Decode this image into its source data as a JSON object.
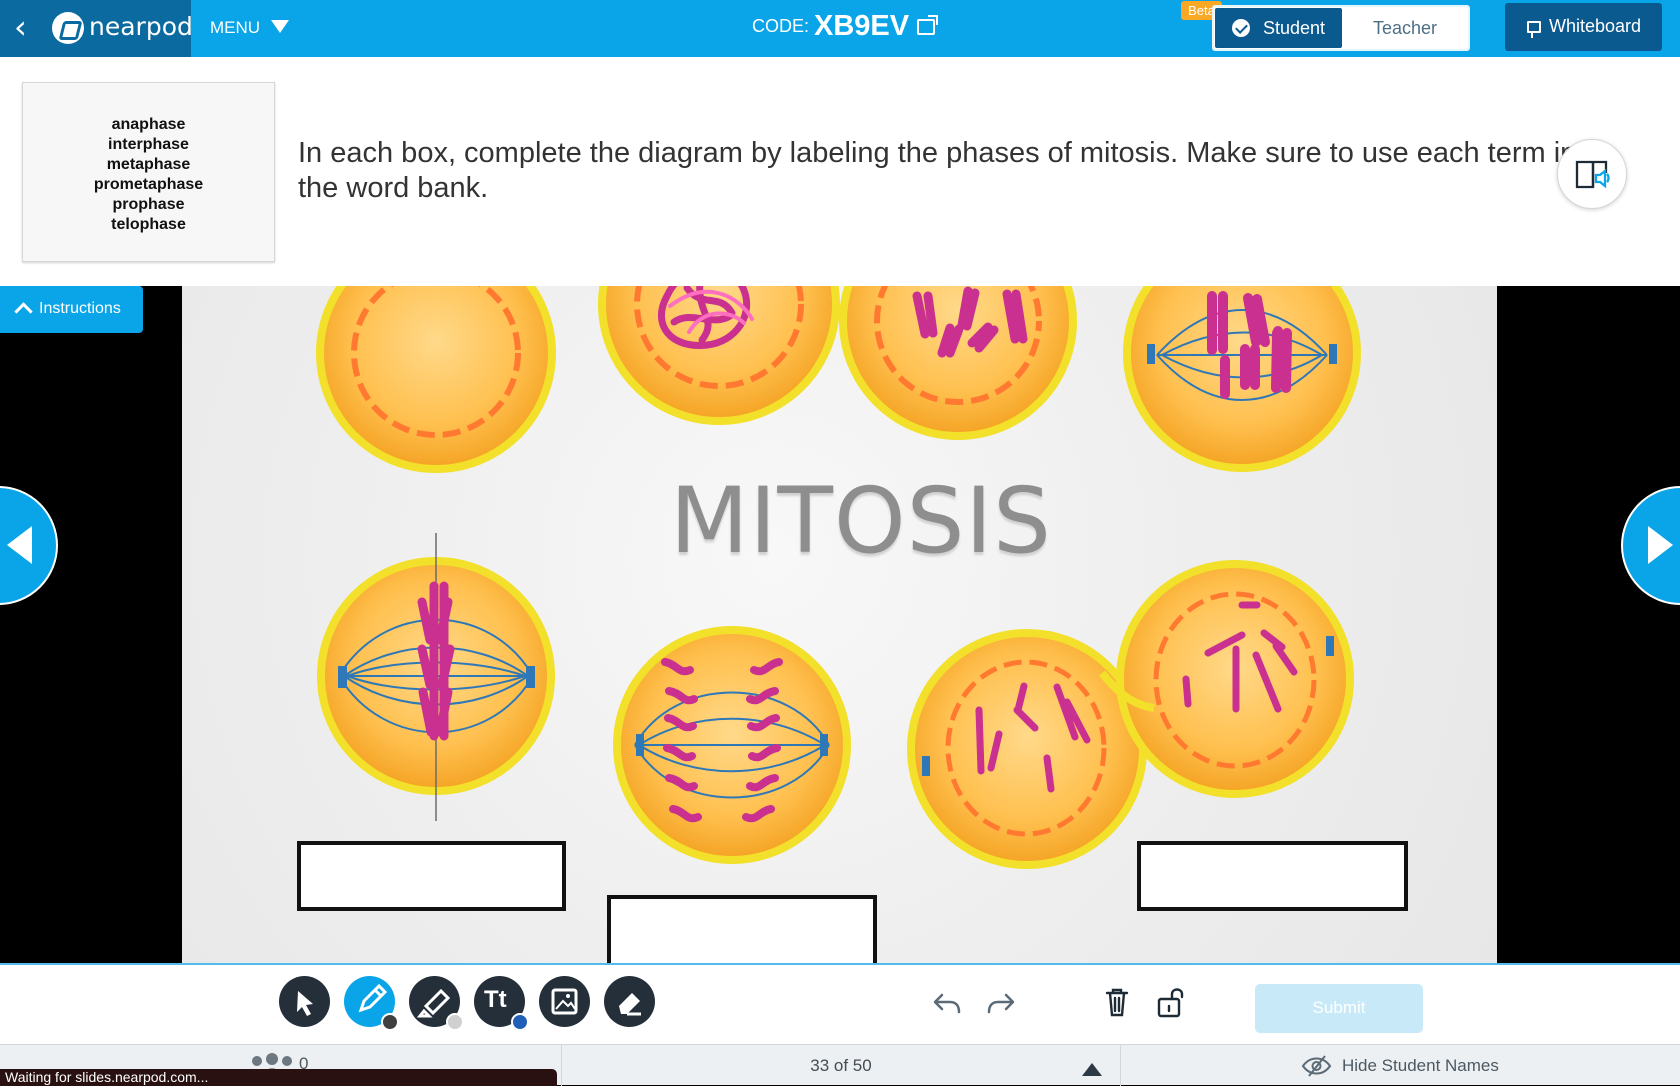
{
  "app": {
    "brand": "nearpod"
  },
  "header": {
    "menu_label": "MENU",
    "code_label": "CODE:",
    "code_value": "XB9EV",
    "beta_badge": "Beta",
    "student_label": "Student",
    "teacher_label": "Teacher",
    "whiteboard_label": "Whiteboard",
    "accent": "#0aa5e8",
    "dark_accent": "#0b5a8f"
  },
  "activity": {
    "word_bank": [
      "anaphase",
      "interphase",
      "metaphase",
      "prometaphase",
      "prophase",
      "telophase"
    ],
    "prompt": "In each box, complete the diagram by labeling the phases of mitosis. Make sure to use each term in the word bank.",
    "slide_title": "MITOSIS",
    "instructions_label": "Instructions"
  },
  "tools": [
    "select-icon",
    "pen-icon",
    "highlighter-icon",
    "text-icon",
    "image-icon",
    "eraser-icon"
  ],
  "toolbar": {
    "text_tool_label": "Tt",
    "submit_label": "Submit"
  },
  "status": {
    "participants": "0",
    "loading": "Waiting for slides.nearpod.com...",
    "slide_counter": "33 of 50",
    "hide_names_label": "Hide Student Names"
  }
}
